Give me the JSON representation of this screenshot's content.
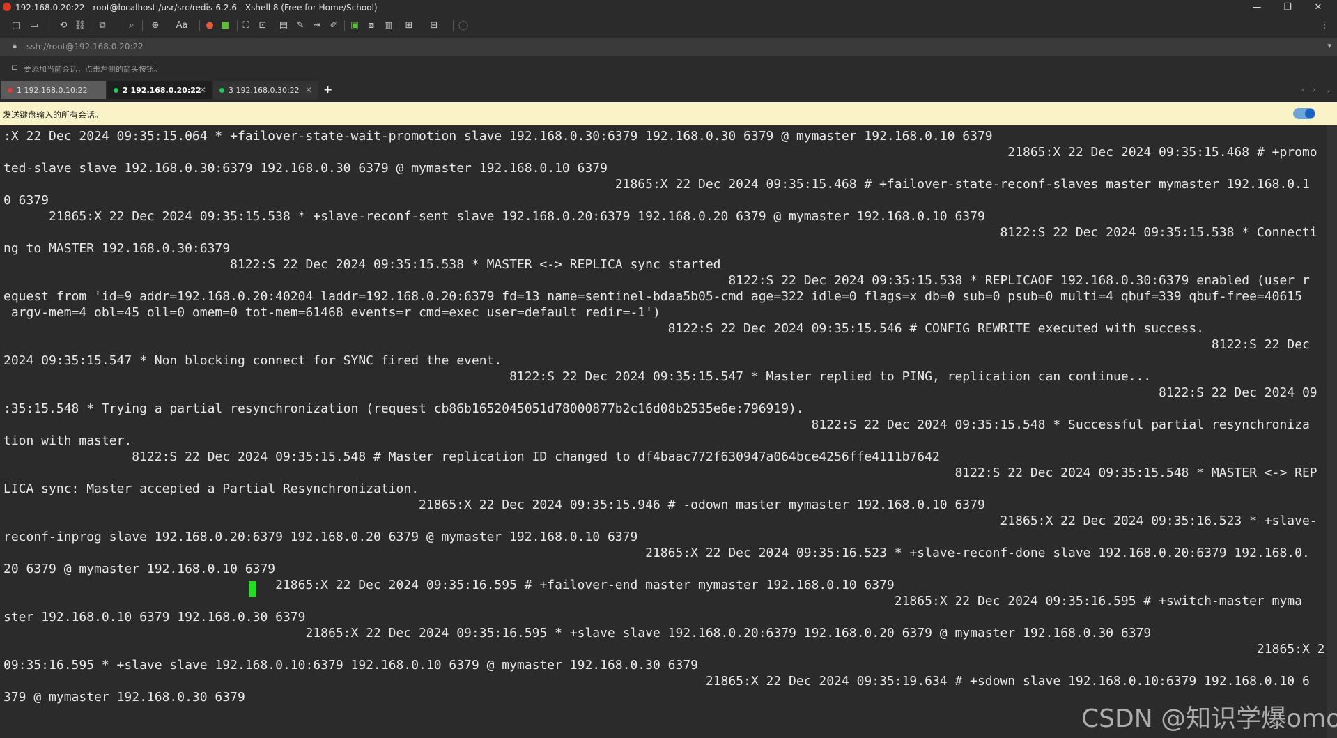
{
  "window": {
    "title": "192.168.0.20:22 - root@localhost:/usr/src/redis-6.2.6 - Xshell 8 (Free for Home/School)",
    "minimize": "—",
    "maximize": "❐",
    "close": "✕"
  },
  "toolbar": {
    "icons": [
      "new-session-icon",
      "open-folder-icon",
      "reconnect-icon",
      "disconnect-icon",
      "new-window-icon",
      "find-icon",
      "globe-icon",
      "font-icon",
      "xshell-icon",
      "xftp-icon",
      "fullscreen-icon",
      "lock-icon",
      "keyboard-icon",
      "compose-icon",
      "transfer-icon",
      "script-icon",
      "tunnel-icon",
      "copy-icon",
      "log-icon",
      "layout-icon",
      "split-icon",
      "help-icon"
    ],
    "font_label": "Aa"
  },
  "address": {
    "value": "ssh://root@192.168.0.20:22"
  },
  "hint": {
    "text": "要添加当前会话，点击左侧的箭头按钮。"
  },
  "tabs": [
    {
      "label": "1 192.168.0.10:22",
      "status_color": "#e03c3c"
    },
    {
      "label": "2 192.168.0.20:22",
      "status_color": "#22c55e",
      "close": "✕"
    },
    {
      "label": "3 192.168.0.30:22",
      "status_color": "#22c55e",
      "close": "✕"
    }
  ],
  "tab_add": "+",
  "send_bar": {
    "text": "发送键盘输入的所有会话。",
    "toggle_on": true
  },
  "terminal": {
    "lines": [
      ":X 22 Dec 2024 09:35:15.064 * +failover-state-wait-promotion slave 192.168.0.30:6379 192.168.0.30 6379 @ mymaster 192.168.0.10 6379",
      "                                                                                                                                     21865:X 22 Dec 2024 09:35:15.468 # +promo",
      "ted-slave slave 192.168.0.30:6379 192.168.0.30 6379 @ mymaster 192.168.0.10 6379",
      "                                                                                 21865:X 22 Dec 2024 09:35:15.468 # +failover-state-reconf-slaves master mymaster 192.168.0.1",
      "0 6379",
      "      21865:X 22 Dec 2024 09:35:15.538 * +slave-reconf-sent slave 192.168.0.20:6379 192.168.0.20 6379 @ mymaster 192.168.0.10 6379",
      "                                                                                                                                    8122:S 22 Dec 2024 09:35:15.538 * Connecti",
      "ng to MASTER 192.168.0.30:6379",
      "                              8122:S 22 Dec 2024 09:35:15.538 * MASTER <-> REPLICA sync started",
      "                                                                                                8122:S 22 Dec 2024 09:35:15.538 * REPLICAOF 192.168.0.30:6379 enabled (user r",
      "equest from 'id=9 addr=192.168.0.20:40204 laddr=192.168.0.20:6379 fd=13 name=sentinel-bdaa5b05-cmd age=322 idle=0 flags=x db=0 sub=0 psub=0 multi=4 qbuf=339 qbuf-free=40615",
      " argv-mem=4 obl=45 oll=0 omem=0 tot-mem=61468 events=r cmd=exec user=default redir=-1')",
      "                                                                                        8122:S 22 Dec 2024 09:35:15.546 # CONFIG REWRITE executed with success.",
      "                                                                                                                                                                8122:S 22 Dec",
      "2024 09:35:15.547 * Non blocking connect for SYNC fired the event.",
      "                                                                   8122:S 22 Dec 2024 09:35:15.547 * Master replied to PING, replication can continue...",
      "                                                                                                                                                         8122:S 22 Dec 2024 09",
      ":35:15.548 * Trying a partial resynchronization (request cb86b1652045051d78000877b2c16d08b2535e6e:796919).",
      "                                                                                                           8122:S 22 Dec 2024 09:35:15.548 * Successful partial resynchroniza",
      "tion with master.",
      "                 8122:S 22 Dec 2024 09:35:15.548 # Master replication ID changed to df4baac772f630947a064bce4256ffe4111b7642",
      "                                                                                                                              8122:S 22 Dec 2024 09:35:15.548 * MASTER <-> REP",
      "LICA sync: Master accepted a Partial Resynchronization.",
      "                                                       21865:X 22 Dec 2024 09:35:15.946 # -odown master mymaster 192.168.0.10 6379",
      "                                                                                                                                    21865:X 22 Dec 2024 09:35:16.523 * +slave-",
      "reconf-inprog slave 192.168.0.20:6379 192.168.0.20 6379 @ mymaster 192.168.0.10 6379",
      "                                                                                     21865:X 22 Dec 2024 09:35:16.523 * +slave-reconf-done slave 192.168.0.20:6379 192.168.0.",
      "20 6379 @ mymaster 192.168.0.10 6379",
      "                                    21865:X 22 Dec 2024 09:35:16.595 # +failover-end master mymaster 192.168.0.10 6379",
      "                                                                                                                      21865:X 22 Dec 2024 09:35:16.595 # +switch-master myma",
      "ster 192.168.0.10 6379 192.168.0.30 6379",
      "                                        21865:X 22 Dec 2024 09:35:16.595 * +slave slave 192.168.0.20:6379 192.168.0.20 6379 @ mymaster 192.168.0.30 6379",
      "                                                                                                                                                                      21865:X 22 Dec 2024",
      "09:35:16.595 * +slave slave 192.168.0.10:6379 192.168.0.10 6379 @ mymaster 192.168.0.30 6379",
      "                                                                                             21865:X 22 Dec 2024 09:35:19.634 # +sdown slave 192.168.0.10:6379 192.168.0.10 6",
      "379 @ mymaster 192.168.0.30 6379"
    ]
  },
  "watermark": "CSDN @知识学爆omo"
}
